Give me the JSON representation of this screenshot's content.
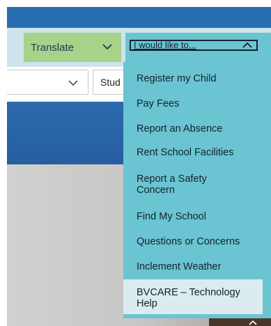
{
  "header": {
    "translate_label": "Translate",
    "want_label": "I would like to..."
  },
  "subbar": {
    "students_label": "Stud"
  },
  "menu": {
    "items": [
      {
        "label": "Register my Child"
      },
      {
        "label": "Pay Fees"
      },
      {
        "label": "Report an Absence"
      },
      {
        "label": "Rent School Facilities"
      },
      {
        "label": "Report a Safety Concern"
      },
      {
        "label": "Find My School"
      },
      {
        "label": "Questions or Concerns"
      },
      {
        "label": "Inclement Weather"
      },
      {
        "label": "BVCARE – Technology Help"
      }
    ],
    "highlighted_index": 8
  },
  "colors": {
    "header_blue": "#2a6eb2",
    "translate_green": "#a6d28a",
    "menu_teal": "#6ac4d2",
    "menu_highlight": "#dcebef"
  },
  "icons": {
    "translate_chevron": "chevron-down-icon",
    "want_chevron": "chevron-up-icon",
    "select_chevron": "chevron-down-icon",
    "corner": "chevron-right-icon"
  }
}
